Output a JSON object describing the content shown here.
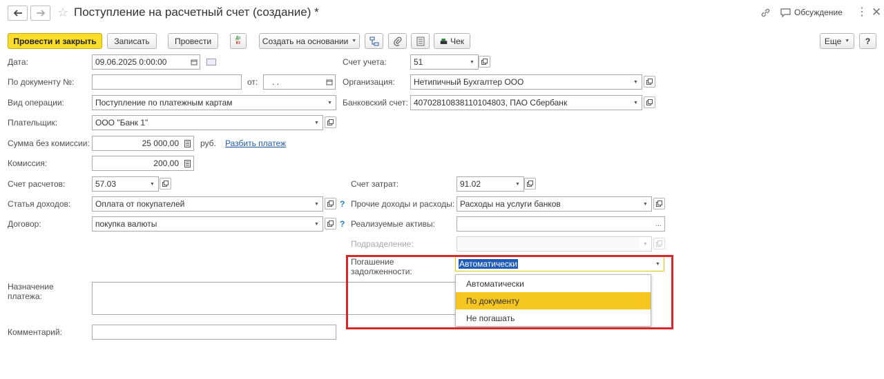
{
  "window": {
    "title": "Поступление на расчетный счет (создание) *",
    "discussion_label": "Обсуждение"
  },
  "toolbar": {
    "post_close": "Провести и закрыть",
    "save": "Записать",
    "post": "Провести",
    "dtkt_top": "Дт",
    "dtkt_bottom": "Кт",
    "create_based": "Создать на основании",
    "check": "Чек",
    "more": "Еще",
    "help": "?"
  },
  "form": {
    "date": {
      "label": "Дата:",
      "value": "09.06.2025  0:00:00"
    },
    "doc_number": {
      "label": "По документу №:",
      "value": "",
      "from_label": "от:",
      "from_value": " .  ."
    },
    "operation": {
      "label": "Вид операции:",
      "value": "Поступление по платежным картам"
    },
    "payer": {
      "label": "Плательщик:",
      "value": "ООО \"Банк 1\""
    },
    "amount": {
      "label": "Сумма без комиссии:",
      "value": "25 000,00",
      "currency": "руб.",
      "split_link": "Разбить платеж"
    },
    "commission": {
      "label": "Комиссия:",
      "value": "200,00"
    },
    "settlement_account": {
      "label": "Счет расчетов:",
      "value": "57.03"
    },
    "income_item": {
      "label": "Статья доходов:",
      "value": "Оплата от покупателей"
    },
    "contract": {
      "label": "Договор:",
      "value": "покупка валюты"
    },
    "purpose": {
      "label_line1": "Назначение",
      "label_line2": "платежа:",
      "value": ""
    },
    "comment": {
      "label": "Комментарий:",
      "value": ""
    },
    "account": {
      "label": "Счет учета:",
      "value": "51"
    },
    "organization": {
      "label": "Организация:",
      "value": "Нетипичный Бухгалтер ООО"
    },
    "bank_account": {
      "label": "Банковский счет:",
      "value": "40702810838110104803, ПАО Сбербанк"
    },
    "cost_account": {
      "label": "Счет затрат:",
      "value": "91.02"
    },
    "other_income_expenses": {
      "label": "Прочие доходы и расходы:",
      "value": "Расходы на услуги банков"
    },
    "assets_sold": {
      "label": "Реализуемые активы:",
      "value": ""
    },
    "department": {
      "label": "Подразделение:",
      "value": ""
    },
    "debt_repayment": {
      "label_line1": "Погашение",
      "label_line2": "задолженности:",
      "value": "Автоматически",
      "options": [
        "Автоматически",
        "По документу",
        "Не погашать"
      ],
      "hovered_option": "По документу"
    }
  },
  "colors": {
    "primary_button": "#fadc2a",
    "highlight_border": "#d8262b",
    "hover_item": "#f6c620",
    "link": "#1e5ca8",
    "help_icon": "#1f7cc7"
  }
}
